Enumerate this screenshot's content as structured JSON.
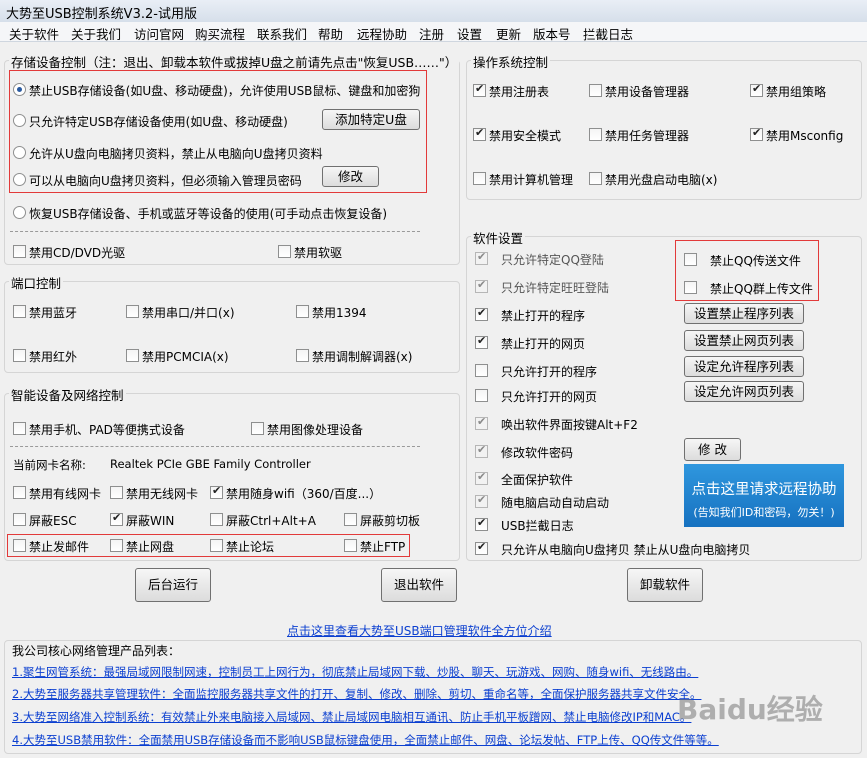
{
  "window": {
    "title": "大势至USB控制系统V3.2-试用版"
  },
  "menu": [
    "关于软件",
    "关于我们",
    "访问官网",
    "购买流程",
    "联系我们",
    "帮助",
    "远程协助",
    "注册",
    "设置",
    "更新",
    "版本号",
    "拦截日志"
  ],
  "storage": {
    "legend": "存储设备控制（注：退出、卸载本软件或拔掉U盘之前请先点击\"恢复USB……\"）",
    "opt_block": "禁止USB存储设备(如U盘、移动硬盘)，允许使用USB鼠标、键盘和加密狗",
    "opt_specific": "只允许特定USB存储设备使用(如U盘、移动硬盘)",
    "btn_add": "添加特定U盘",
    "opt_u_to_pc": "允许从U盘向电脑拷贝资料，禁止从电脑向U盘拷贝资料",
    "opt_pc_to_u": "可以从电脑向U盘拷贝资料，但必须输入管理员密码",
    "btn_modify": "修改",
    "opt_restore": "恢复USB存储设备、手机或蓝牙等设备的使用(可手动点击恢复设备)",
    "cd": "禁用CD/DVD光驱",
    "floppy": "禁用软驱"
  },
  "port": {
    "legend": "端口控制",
    "bt": "禁用蓝牙",
    "serial": "禁用串口/并口(x)",
    "p1394": "禁用1394",
    "ir": "禁用红外",
    "pcmcia": "禁用PCMCIA(x)",
    "modem": "禁用调制解调器(x)"
  },
  "smart": {
    "legend": "智能设备及网络控制",
    "phone": "禁用手机、PAD等便携式设备",
    "imaging": "禁用图像处理设备",
    "nic_label": "当前网卡名称:",
    "nic_name": "Realtek PCIe GBE Family Controller",
    "wired": "禁用有线网卡",
    "wireless": "禁用无线网卡",
    "wifi": "禁用随身wifi（360/百度...）",
    "esc": "屏蔽ESC",
    "win": "屏蔽WIN",
    "cad": "屏蔽Ctrl+Alt+A",
    "clip": "屏蔽剪切板",
    "mail": "禁止发邮件",
    "netdisk": "禁止网盘",
    "forum": "禁止论坛",
    "ftp": "禁止FTP"
  },
  "os": {
    "legend": "操作系统控制",
    "regedit": "禁用注册表",
    "devmgr": "禁用设备管理器",
    "gpedit": "禁用组策略",
    "safemode": "禁用安全模式",
    "taskmgr": "禁用任务管理器",
    "msconfig": "禁用Msconfig",
    "compmgmt": "禁用计算机管理",
    "cdboot": "禁用光盘启动电脑(x)"
  },
  "soft": {
    "legend": "软件设置",
    "qq_only": "只允许特定QQ登陆",
    "ww_only": "只允许特定旺旺登陆",
    "qq_file": "禁止QQ传送文件",
    "qq_group": "禁止QQ群上传文件",
    "block_prog": "禁止打开的程序",
    "btn_prog": "设置禁止程序列表",
    "block_web": "禁止打开的网页",
    "btn_web": "设置禁止网页列表",
    "allow_prog": "只允许打开的程序",
    "btn_allow_prog": "设定允许程序列表",
    "allow_web": "只允许打开的网页",
    "btn_allow_web": "设定允许网页列表",
    "hotkey": "唤出软件界面按键Alt+F2",
    "pwd": "修改软件密码",
    "btn_pwd": "修 改",
    "protect": "全面保护软件",
    "autostart": "随电脑启动自动启动",
    "usblog": "USB拦截日志",
    "u_copy": "只允许从电脑向U盘拷贝 禁止从U盘向电脑拷贝",
    "remote_title": "点击这里请求远程协助",
    "remote_sub": "(告知我们ID和密码，勿关！)"
  },
  "buttons": {
    "bg": "后台运行",
    "exit": "退出软件",
    "uninstall": "卸载软件"
  },
  "intro_link": "点击这里查看大势至USB端口管理软件全方位介绍",
  "products": {
    "title": "我公司核心网络管理产品列表：",
    "items": [
      "1.聚生网管系统：最强局域网限制网速，控制员工上网行为，彻底禁止局域网下载、炒股、聊天、玩游戏、网购、随身wifi、无线路由。",
      "2.大势至服务器共享管理软件：全面监控服务器共享文件的打开、复制、修改、删除、剪切、重命名等，全面保护服务器共享文件安全。",
      "3.大势至网络准入控制系统：有效禁止外来电脑接入局域网、禁止局域网电脑相互通讯、防止手机平板蹭网、禁止电脑修改IP和MAC。",
      "4.大势至USB禁用软件：全面禁用USB存储设备而不影响USB鼠标键盘使用，全面禁止邮件、网盘、论坛发帖、FTP上传、QQ传文件等等。"
    ]
  },
  "watermark": "Baidu经验"
}
